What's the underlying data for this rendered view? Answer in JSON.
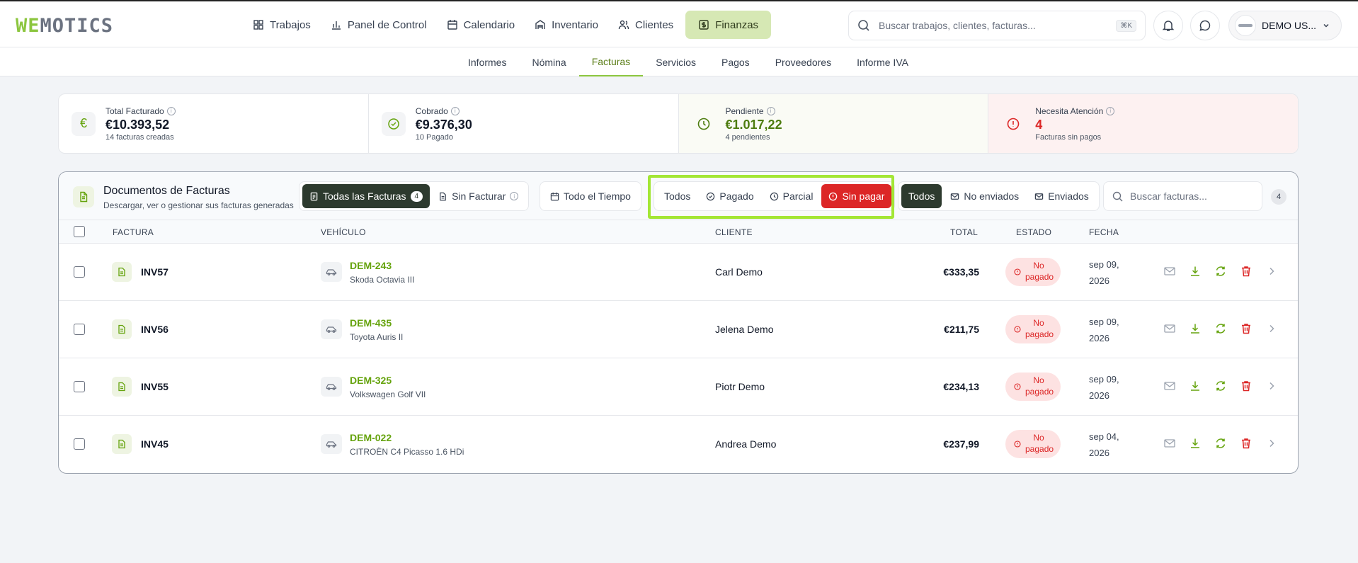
{
  "app": {
    "logo_we": "WE",
    "logo_rest": "MOTICS"
  },
  "nav": {
    "items": [
      {
        "label": "Trabajos",
        "icon": "grid-icon"
      },
      {
        "label": "Panel de Control",
        "icon": "bar-chart-icon"
      },
      {
        "label": "Calendario",
        "icon": "calendar-icon"
      },
      {
        "label": "Inventario",
        "icon": "warehouse-icon"
      },
      {
        "label": "Clientes",
        "icon": "users-icon"
      },
      {
        "label": "Finanzas",
        "icon": "dollar-icon",
        "active": true
      }
    ]
  },
  "search": {
    "placeholder": "Buscar trabajos, clientes, facturas...",
    "shortcut": "⌘K"
  },
  "user": {
    "name": "DEMO US..."
  },
  "subnav": {
    "items": [
      "Informes",
      "Nómina",
      "Facturas",
      "Servicios",
      "Pagos",
      "Proveedores",
      "Informe IVA"
    ],
    "active": "Facturas"
  },
  "stats": [
    {
      "label": "Total Facturado",
      "value": "€10.393,52",
      "sub": "14 facturas creadas"
    },
    {
      "label": "Cobrado",
      "value": "€9.376,30",
      "sub": "10 Pagado"
    },
    {
      "label": "Pendiente",
      "value": "€1.017,22",
      "sub": "4 pendientes"
    },
    {
      "label": "Necesita Atención",
      "value": "4",
      "sub": "Facturas sin pagos"
    }
  ],
  "toolbar": {
    "title": "Documentos de Facturas",
    "subtitle": "Descargar, ver o gestionar sus facturas generadas",
    "all_invoices": "Todas las Facturas",
    "all_count": "4",
    "unbilled": "Sin Facturar",
    "all_time": "Todo el Tiempo",
    "pay_filters": {
      "all": "Todos",
      "paid": "Pagado",
      "partial": "Parcial",
      "unpaid": "Sin pagar"
    },
    "send_filters": {
      "all": "Todos",
      "not_sent": "No enviados",
      "sent": "Enviados"
    },
    "search_placeholder": "Buscar facturas...",
    "result_count": "4"
  },
  "table": {
    "headers": {
      "invoice": "FACTURA",
      "vehicle": "VEHÍCULO",
      "client": "CLIENTE",
      "total": "TOTAL",
      "status": "ESTADO",
      "date": "FECHA"
    },
    "rows": [
      {
        "invoice": "INV57",
        "plate": "DEM-243",
        "model": "Skoda Octavia III",
        "client": "Carl Demo",
        "total": "€333,35",
        "status": "No pagado",
        "date": "sep 09, 2026"
      },
      {
        "invoice": "INV56",
        "plate": "DEM-435",
        "model": "Toyota Auris II",
        "client": "Jelena Demo",
        "total": "€211,75",
        "status": "No pagado",
        "date": "sep 09, 2026"
      },
      {
        "invoice": "INV55",
        "plate": "DEM-325",
        "model": "Volkswagen Golf VII",
        "client": "Piotr Demo",
        "total": "€234,13",
        "status": "No pagado",
        "date": "sep 09, 2026"
      },
      {
        "invoice": "INV45",
        "plate": "DEM-022",
        "model": "CITROËN C4 Picasso 1.6 HDi",
        "client": "Andrea Demo",
        "total": "€237,99",
        "status": "No pagado",
        "date": "sep 04, 2026"
      }
    ]
  },
  "colors": {
    "brand": "#8cc63f",
    "active_nav": "#d6e8b4",
    "danger": "#dc2626",
    "dark": "#2d3a2e"
  }
}
